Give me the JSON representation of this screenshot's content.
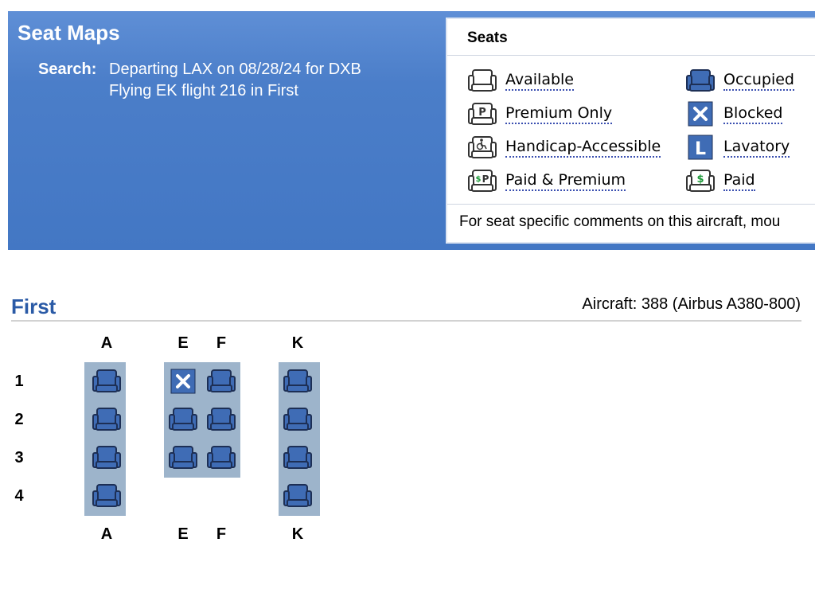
{
  "banner": {
    "title": "Seat Maps",
    "search_label": "Search:",
    "search_line1": "Departing LAX on 08/28/24 for DXB",
    "search_line2": "Flying EK flight 216 in First"
  },
  "legend": {
    "title": "Seats",
    "items": [
      {
        "label": "Available",
        "icon": "available-seat-icon"
      },
      {
        "label": "Occupied",
        "icon": "occupied-seat-icon"
      },
      {
        "label": "Premium Only",
        "icon": "premium-seat-icon"
      },
      {
        "label": "Blocked",
        "icon": "blocked-seat-icon"
      },
      {
        "label": "Handicap-Accessible",
        "icon": "handicap-seat-icon"
      },
      {
        "label": "Lavatory",
        "icon": "lavatory-icon"
      },
      {
        "label": "Paid & Premium",
        "icon": "paid-premium-seat-icon"
      },
      {
        "label": "Paid",
        "icon": "paid-seat-icon"
      }
    ],
    "footer": "For seat specific comments on this aircraft, mou"
  },
  "cabin": {
    "name": "First",
    "aircraft": "Aircraft: 388 (Airbus A380-800)",
    "columns": [
      "A",
      "E",
      "F",
      "K"
    ],
    "rows": [
      "1",
      "2",
      "3",
      "4"
    ],
    "seats": [
      {
        "seat": "1A",
        "status": "occupied"
      },
      {
        "seat": "1E",
        "status": "blocked"
      },
      {
        "seat": "1F",
        "status": "occupied"
      },
      {
        "seat": "1K",
        "status": "occupied"
      },
      {
        "seat": "2A",
        "status": "occupied"
      },
      {
        "seat": "2E",
        "status": "occupied"
      },
      {
        "seat": "2F",
        "status": "occupied"
      },
      {
        "seat": "2K",
        "status": "occupied"
      },
      {
        "seat": "3A",
        "status": "occupied"
      },
      {
        "seat": "3E",
        "status": "occupied"
      },
      {
        "seat": "3F",
        "status": "occupied"
      },
      {
        "seat": "3K",
        "status": "occupied"
      },
      {
        "seat": "4A",
        "status": "occupied"
      },
      {
        "seat": "4K",
        "status": "occupied"
      }
    ]
  },
  "colors": {
    "banner_blue": "#4377c4",
    "seat_blue": "#3f6cb5",
    "seat_block": "#9db4cb",
    "title_blue": "#2a5aa6"
  }
}
